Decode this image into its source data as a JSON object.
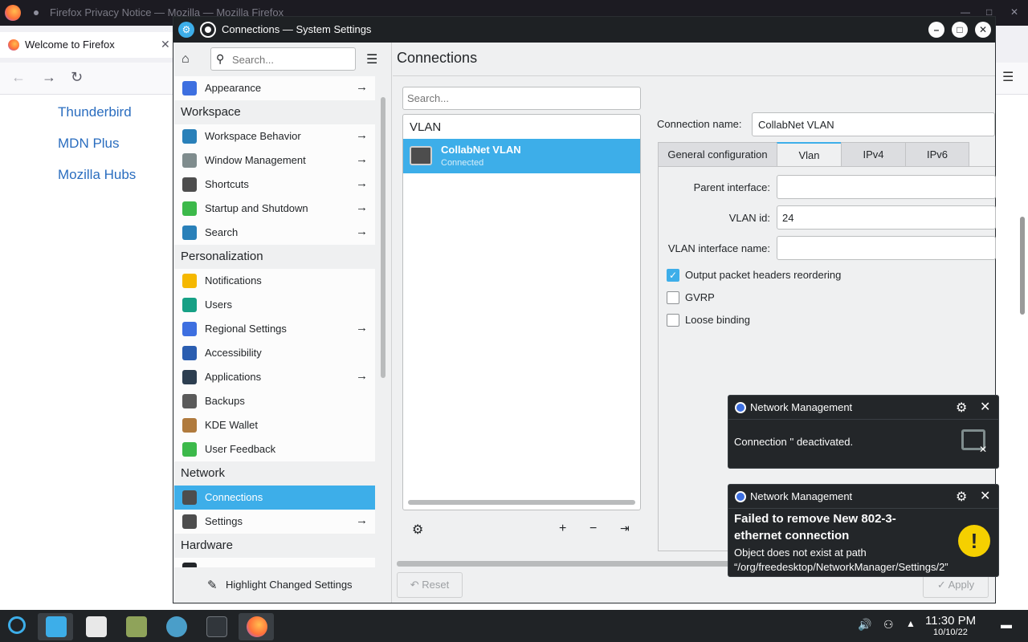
{
  "firefox": {
    "window_title": "Firefox Privacy Notice — Mozilla — Mozilla Firefox",
    "tab_label": "Welcome to Firefox",
    "links": [
      "Thunderbird",
      "MDN Plus",
      "Mozilla Hubs"
    ]
  },
  "window": {
    "title": "Connections — System Settings"
  },
  "sidebar": {
    "search_placeholder": "Search...",
    "items": [
      {
        "label": "Appearance",
        "arrow": true,
        "icon": "appearance-icon",
        "color": "#3d6fe0"
      },
      {
        "section": "Workspace"
      },
      {
        "label": "Workspace Behavior",
        "arrow": true,
        "icon": "workspace-behavior-icon",
        "color": "#2980b9"
      },
      {
        "label": "Window Management",
        "arrow": true,
        "icon": "window-management-icon",
        "color": "#7f8c8d"
      },
      {
        "label": "Shortcuts",
        "arrow": true,
        "icon": "keyboard-icon",
        "color": "#4d4d4d"
      },
      {
        "label": "Startup and Shutdown",
        "arrow": true,
        "icon": "startup-icon",
        "color": "#3cb94a"
      },
      {
        "label": "Search",
        "arrow": true,
        "icon": "search-icon",
        "color": "#2980b9"
      },
      {
        "section": "Personalization"
      },
      {
        "label": "Notifications",
        "arrow": false,
        "icon": "bell-icon",
        "color": "#f5b800"
      },
      {
        "label": "Users",
        "arrow": false,
        "icon": "user-icon",
        "color": "#16a085"
      },
      {
        "label": "Regional Settings",
        "arrow": true,
        "icon": "regional-icon",
        "color": "#3d6fe0"
      },
      {
        "label": "Accessibility",
        "arrow": false,
        "icon": "accessibility-icon",
        "color": "#2a5db0"
      },
      {
        "label": "Applications",
        "arrow": true,
        "icon": "applications-icon",
        "color": "#2c3e50"
      },
      {
        "label": "Backups",
        "arrow": false,
        "icon": "backups-icon",
        "color": "#5a5a5a"
      },
      {
        "label": "KDE Wallet",
        "arrow": false,
        "icon": "wallet-icon",
        "color": "#b07a3d"
      },
      {
        "label": "User Feedback",
        "arrow": false,
        "icon": "feedback-icon",
        "color": "#3cb94a"
      },
      {
        "section": "Network"
      },
      {
        "label": "Connections",
        "arrow": false,
        "icon": "network-icon",
        "color": "#4d4d4d",
        "selected": true
      },
      {
        "label": "Settings",
        "arrow": true,
        "icon": "network-settings-icon",
        "color": "#4d4d4d"
      },
      {
        "section": "Hardware"
      },
      {
        "label": "",
        "arrow": true,
        "icon": "hardware-icon",
        "color": "#232629"
      }
    ],
    "highlight_label": "Highlight Changed Settings"
  },
  "main": {
    "title": "Connections",
    "search_placeholder": "Search...",
    "group_label": "VLAN",
    "connection": {
      "name": "CollabNet VLAN",
      "status": "Connected"
    },
    "connection_name_label": "Connection name:",
    "connection_name_value": "CollabNet VLAN",
    "tabs": [
      "General configuration",
      "Vlan",
      "IPv4",
      "IPv6"
    ],
    "active_tab": 1,
    "fields": [
      {
        "label": "Parent interface:",
        "value": ""
      },
      {
        "label": "VLAN id:",
        "value": "24"
      },
      {
        "label": "VLAN interface name:",
        "value": ""
      }
    ],
    "checkboxes": [
      {
        "label": "Output packet headers reordering",
        "checked": true
      },
      {
        "label": "GVRP",
        "checked": false
      },
      {
        "label": "Loose binding",
        "checked": false
      }
    ],
    "reset_label": "Reset",
    "apply_label": "Apply"
  },
  "notifications": [
    {
      "app": "Network Management",
      "title": "",
      "body": "Connection '' deactivated."
    },
    {
      "app": "Network Management",
      "title": "Failed to remove New 802-3-ethernet connection",
      "body": "Object does not exist at path “/org/freedesktop/NetworkManager/Settings/2”"
    }
  ],
  "taskbar": {
    "time": "11:30 PM",
    "date": "10/10/22"
  },
  "colors": {
    "accent": "#3daee9",
    "titlebar": "#1e2124",
    "warning": "#f5d000"
  }
}
